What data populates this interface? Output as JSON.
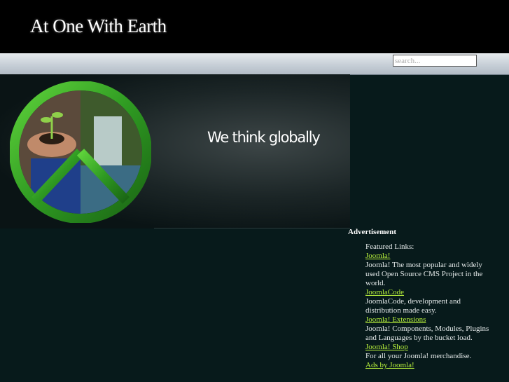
{
  "header": {
    "site_title": "At One With Earth"
  },
  "search": {
    "placeholder": "search..."
  },
  "banner": {
    "tagline": "We think globally"
  },
  "advertisement": {
    "title": "Advertisement",
    "intro": "Featured Links:",
    "links": [
      {
        "label": "Joomla!",
        "description": "Joomla! The most popular and widely used Open Source CMS Project in the world."
      },
      {
        "label": "JoomlaCode",
        "description": "JoomlaCode, development and distribution made easy."
      },
      {
        "label": "Joomla! Extensions",
        "description": "Joomla! Components, Modules, Plugins and Languages by the bucket load."
      },
      {
        "label": "Joomla! Shop",
        "description": "For all your Joomla! merchandise."
      }
    ],
    "footer_link": "Ads by Joomla!"
  },
  "colors": {
    "header_bg": "#000000",
    "page_bg": "#071a1b",
    "link": "#b9f23c"
  }
}
